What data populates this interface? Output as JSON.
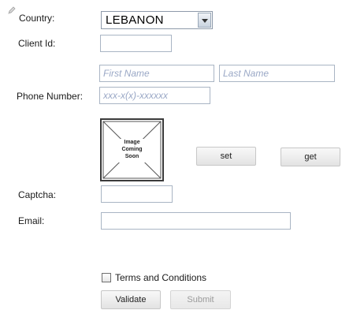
{
  "country": {
    "label": "Country:",
    "selected": "LEBANON"
  },
  "client_id": {
    "label": "Client Id:",
    "value": ""
  },
  "name": {
    "first_placeholder": "First Name",
    "last_placeholder": "Last Name"
  },
  "phone": {
    "label": "Phone Number:",
    "placeholder": "xxx-x(x)-xxxxxx"
  },
  "image": {
    "caption": "Image\nComing\nSoon"
  },
  "actions": {
    "set_label": "set",
    "get_label": "get"
  },
  "captcha": {
    "label": "Captcha:",
    "value": ""
  },
  "email": {
    "label": "Email:",
    "value": ""
  },
  "terms": {
    "label": "Terms and Conditions",
    "checked": false
  },
  "buttons": {
    "validate_label": "Validate",
    "submit_label": "Submit"
  }
}
